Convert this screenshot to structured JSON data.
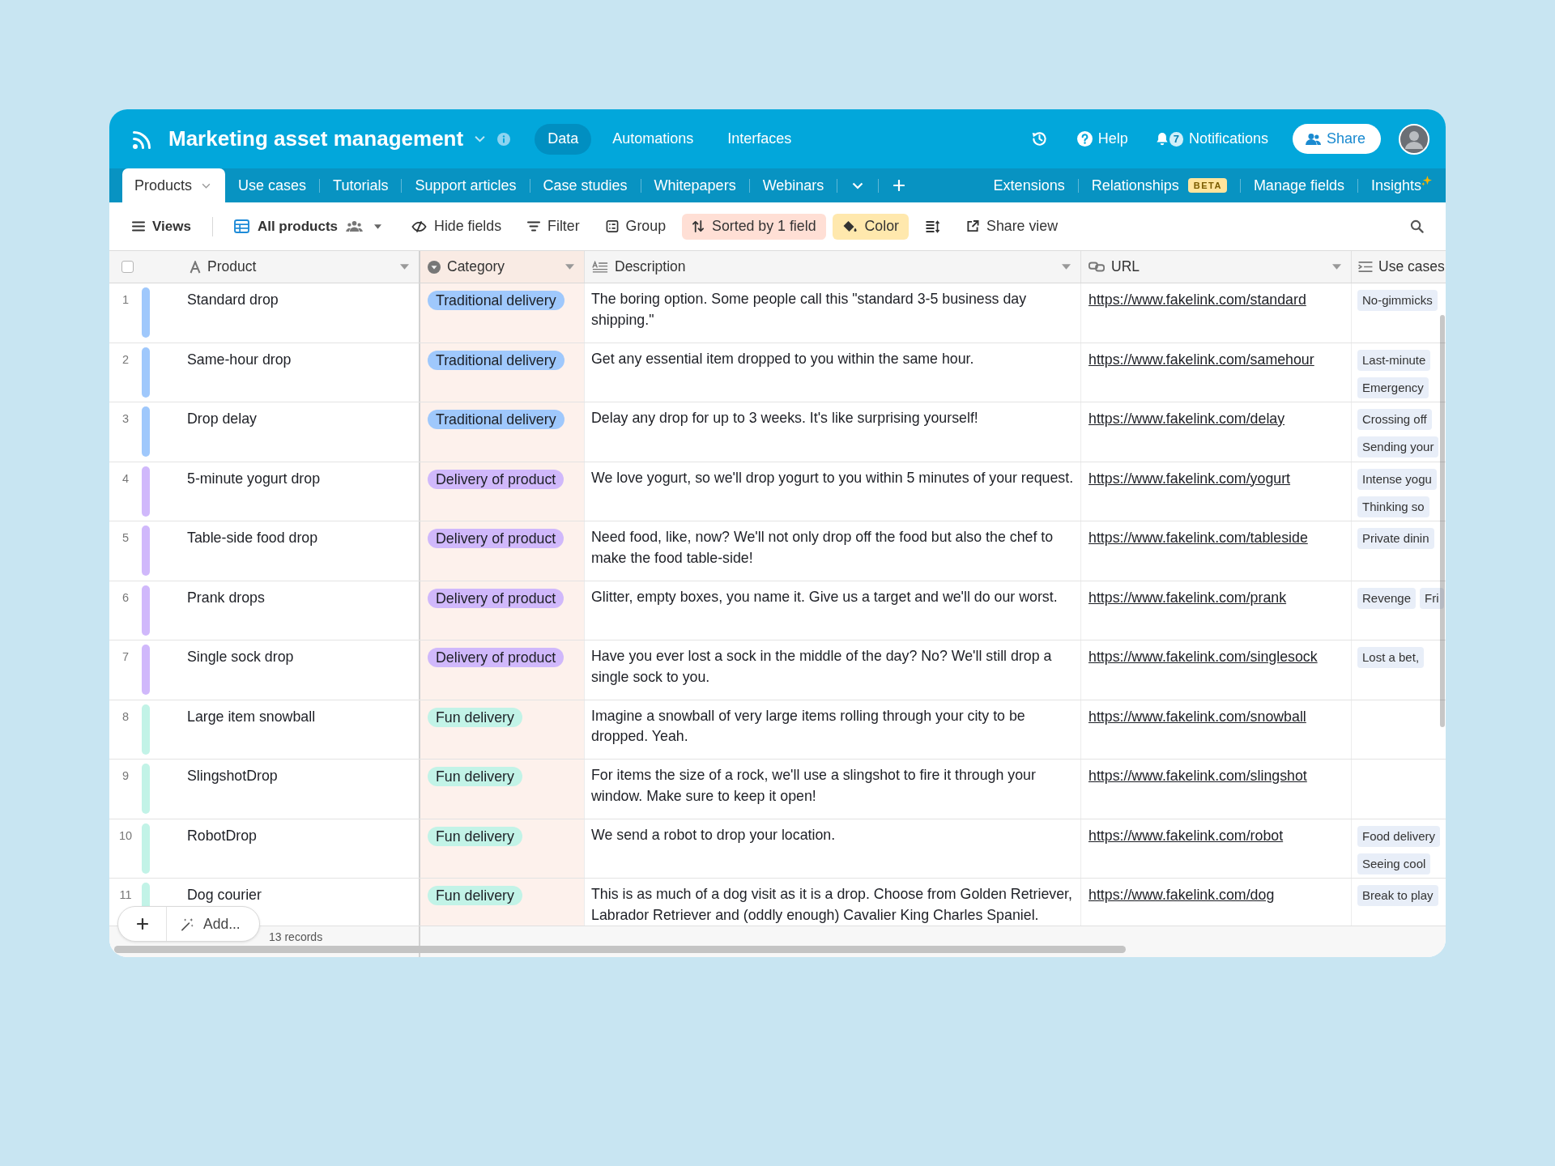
{
  "header": {
    "title": "Marketing asset management",
    "nav": [
      {
        "label": "Data",
        "selected": true
      },
      {
        "label": "Automations",
        "selected": false
      },
      {
        "label": "Interfaces",
        "selected": false
      }
    ],
    "help": "Help",
    "notifications": {
      "label": "Notifications",
      "count": "7"
    },
    "share": "Share"
  },
  "tabs": [
    {
      "label": "Products",
      "selected": true
    },
    {
      "label": "Use cases",
      "selected": false
    },
    {
      "label": "Tutorials",
      "selected": false
    },
    {
      "label": "Support articles",
      "selected": false
    },
    {
      "label": "Case studies",
      "selected": false
    },
    {
      "label": "Whitepapers",
      "selected": false
    },
    {
      "label": "Webinars",
      "selected": false
    }
  ],
  "tab_actions": [
    {
      "kind": "plain",
      "label": "Extensions"
    },
    {
      "kind": "plain",
      "label": "Relationships",
      "badge": "BETA"
    },
    {
      "kind": "plain",
      "label": "Manage fields"
    },
    {
      "kind": "sparkle",
      "label": "Insights"
    }
  ],
  "toolbar": {
    "views": "Views",
    "view_name": "All products",
    "items": [
      {
        "kind": "hide_fields",
        "label": "Hide fields",
        "active": false
      },
      {
        "kind": "filter",
        "label": "Filter",
        "active": false
      },
      {
        "kind": "group",
        "label": "Group",
        "active": false
      },
      {
        "kind": "sort",
        "label": "Sorted by 1 field",
        "active": true
      },
      {
        "kind": "color",
        "label": "Color",
        "active": true
      },
      {
        "kind": "row_height",
        "active": false
      },
      {
        "kind": "share_view",
        "label": "Share view",
        "active": false
      }
    ]
  },
  "table": {
    "select_all": {
      "checked": false
    },
    "columns": [
      {
        "kind": "text",
        "name": "Product",
        "dropdown": true,
        "sorted": false
      },
      {
        "kind": "single_select",
        "name": "Category",
        "dropdown": true,
        "sorted": true
      },
      {
        "kind": "long_text",
        "name": "Description",
        "dropdown": true,
        "sorted": false
      },
      {
        "kind": "url",
        "name": "URL",
        "dropdown": true,
        "sorted": false
      },
      {
        "kind": "multi_select",
        "name": "Use cases",
        "sorted": false
      }
    ],
    "rows": [
      {
        "number": "1",
        "product": "Standard drop",
        "color": "#9fc8fc",
        "category": "Traditional delivery",
        "description": "The boring option. Some people call this \"standard 3-5 business day shipping.\"",
        "url": "https://www.fakelink.com/standard",
        "use_cases": [
          "No-gimmicks"
        ]
      },
      {
        "number": "2",
        "product": "Same-hour drop",
        "color": "#9fc8fc",
        "category": "Traditional delivery",
        "description": "Get any essential item dropped to you within the same hour.",
        "url": "https://www.fakelink.com/samehour",
        "use_cases": [
          "Last-minute",
          "Emergency"
        ]
      },
      {
        "number": "3",
        "product": "Drop delay",
        "color": "#9fc8fc",
        "category": "Traditional delivery",
        "description": "Delay any drop for up to 3 weeks. It's like surprising yourself!",
        "url": "https://www.fakelink.com/delay",
        "use_cases": [
          "Crossing off",
          "Sending your"
        ]
      },
      {
        "number": "4",
        "product": "5-minute yogurt drop",
        "color": "#d0b8fb",
        "category": "Delivery of product",
        "description": "We love yogurt, so we'll drop yogurt to you within 5 minutes of your request.",
        "url": "https://www.fakelink.com/yogurt",
        "use_cases": [
          "Intense yogu",
          "Thinking so"
        ]
      },
      {
        "number": "5",
        "product": "Table-side food drop",
        "color": "#d0b8fb",
        "category": "Delivery of product",
        "description": "Need food, like, now? We'll not only drop off the food but also the chef to make the food table-side!",
        "url": "https://www.fakelink.com/tableside",
        "use_cases": [
          "Private dinin"
        ]
      },
      {
        "number": "6",
        "product": "Prank drops",
        "color": "#d0b8fb",
        "category": "Delivery of product",
        "description": "Glitter, empty boxes, you name it. Give us a target and we'll do our worst.",
        "url": "https://www.fakelink.com/prank",
        "use_cases": [
          "Revenge",
          "Fri"
        ]
      },
      {
        "number": "7",
        "product": "Single sock drop",
        "color": "#d0b8fb",
        "category": "Delivery of product",
        "description": "Have you ever lost a sock in the middle of the day? No? We'll still drop a single sock to you.",
        "url": "https://www.fakelink.com/singlesock",
        "use_cases": [
          "Lost a bet,"
        ]
      },
      {
        "number": "8",
        "product": "Large item snowball",
        "color": "#c2f3e7",
        "category": "Fun delivery",
        "description": "Imagine a snowball of very large items rolling through your city to be dropped. Yeah.",
        "url": "https://www.fakelink.com/snowball"
      },
      {
        "number": "9",
        "product": "SlingshotDrop",
        "color": "#c2f3e7",
        "category": "Fun delivery",
        "description": "For items the size of a rock, we'll use a slingshot to fire it through your window. Make sure to keep it open!",
        "url": "https://www.fakelink.com/slingshot"
      },
      {
        "number": "10",
        "product": "RobotDrop",
        "color": "#c2f3e7",
        "category": "Fun delivery",
        "description": "We send a robot to drop your location.",
        "url": "https://www.fakelink.com/robot",
        "use_cases": [
          "Food delivery",
          "Seeing cool"
        ]
      },
      {
        "number": "11",
        "product": "Dog courier",
        "color": "#c2f3e7",
        "category": "Fun delivery",
        "description": "This is as much of a dog visit as it is a drop. Choose from Golden Retriever, Labrador Retriever and (oddly enough) Cavalier King Charles Spaniel.",
        "url": "https://www.fakelink.com/dog",
        "use_cases": [
          "Break to play"
        ]
      }
    ]
  },
  "footer": {
    "add": "Add...",
    "records": "13 records"
  }
}
